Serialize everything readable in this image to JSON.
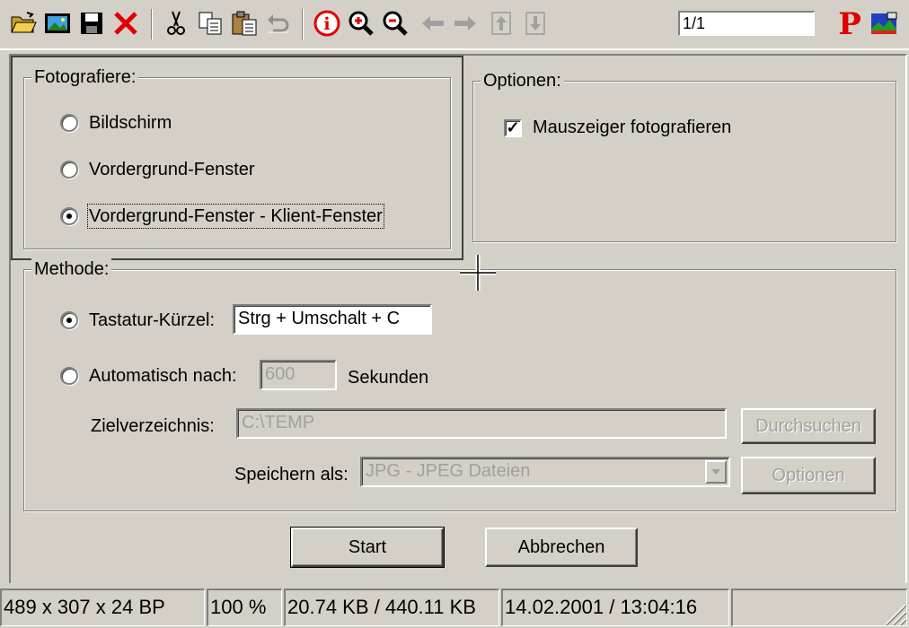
{
  "toolbar": {
    "items": [
      "open-icon",
      "image-icon",
      "save-icon",
      "delete-icon",
      "cut-icon",
      "copy-icon",
      "paste-icon",
      "undo-icon",
      "info-icon",
      "zoom-in-icon",
      "zoom-out-icon",
      "back-arrow-icon",
      "forward-arrow-icon",
      "page-up-icon",
      "page-down-icon"
    ],
    "page_value": "1/1",
    "p_label": "P"
  },
  "capture_group": {
    "title": "Fotografiere:",
    "options": [
      {
        "label": "Bildschirm",
        "selected": false
      },
      {
        "label": "Vordergrund-Fenster",
        "selected": false
      },
      {
        "label": "Vordergrund-Fenster - Klient-Fenster",
        "selected": true
      }
    ]
  },
  "options_group": {
    "title": "Optionen:",
    "mouse_pointer_label": "Mauszeiger fotografieren",
    "mouse_pointer_checked": true
  },
  "method_group": {
    "title": "Methode:",
    "hotkey_label": "Tastatur-Kürzel:",
    "hotkey_value": "Strg + Umschalt + C",
    "hotkey_selected": true,
    "auto_label": "Automatisch nach:",
    "auto_value": "600",
    "auto_unit": "Sekunden",
    "target_dir_label": "Zielverzeichnis:",
    "target_dir_value": "C:\\TEMP",
    "browse_label": "Durchsuchen",
    "save_as_label": "Speichern als:",
    "save_as_value": "JPG - JPEG Dateien",
    "options_button_label": "Optionen"
  },
  "actions": {
    "start_label": "Start",
    "cancel_label": "Abbrechen"
  },
  "statusbar": {
    "dimensions": "489 x 307 x 24 BP",
    "zoom": "100 %",
    "size": "20.74 KB / 440.11 KB",
    "datetime": "14.02.2001 / 13:04:16"
  },
  "colors": {
    "face": "#d4d0c8",
    "shadow": "#808080",
    "highlight": "#ffffff",
    "accent_red": "#e00000",
    "disabled_text": "#a0a0a0"
  }
}
